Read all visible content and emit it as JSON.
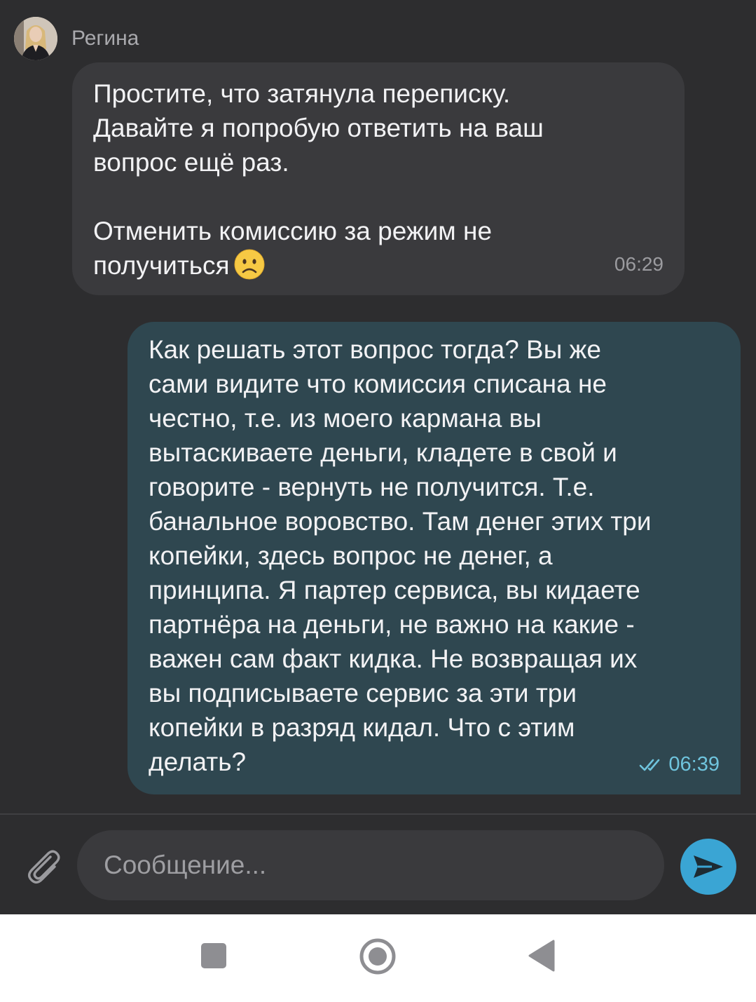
{
  "contact": {
    "name": "Регина",
    "avatar_icon": "user-avatar-icon"
  },
  "messages": [
    {
      "direction": "incoming",
      "paragraph1": "Простите, что затянула переписку.\nДавайте я попробую ответить на ваш\nвопрос ещё раз.",
      "paragraph2": "Отменить комиссию за режим не\nполучиться",
      "emoji": "slightly-frowning-face-icon",
      "time": "06:29"
    },
    {
      "direction": "outgoing",
      "text": "Как решать этот вопрос тогда? Вы же\nсами видите что комиссия списана не\nчестно, т.е. из моего кармана вы\nвытаскиваете деньги, кладете в свой и\nговорите - вернуть не получится. Т.е.\nбанальное воровство. Там денег этих три\nкопейки, здесь вопрос не денег, а\nпринципа. Я партер сервиса, вы кидаете\nпартнёра на деньги, не важно на какие -\nважен сам факт кидка. Не возвращая их\nвы подписываете сервис за эти три\nкопейки в разряд кидал. Что с этим\nделать?",
      "status_icon": "double-check-icon",
      "time": "06:39"
    }
  ],
  "composer": {
    "placeholder": "Сообщение...",
    "attach_icon": "paperclip-icon",
    "send_icon": "send-icon"
  },
  "navigation": {
    "recent_icon": "square-icon",
    "home_icon": "circle-icon",
    "back_icon": "triangle-back-icon"
  },
  "colors": {
    "background": "#2d2d2f",
    "incoming_bubble": "#3a3a3d",
    "outgoing_bubble": "#2f4750",
    "accent": "#3aa5d4",
    "read_status": "#6fc4dd"
  }
}
